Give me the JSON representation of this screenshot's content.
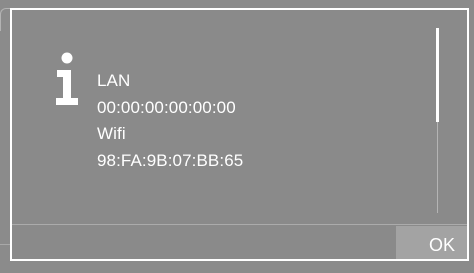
{
  "dialog": {
    "icon": "info-icon",
    "lines": {
      "lan_label": "LAN",
      "lan_mac": "00:00:00:00:00:00",
      "wifi_label": "Wifi",
      "wifi_mac": "98:FA:9B:07:BB:65"
    },
    "ok_label": "OK"
  },
  "colors": {
    "background": "#8b8b8b",
    "dialog_border": "#ffffff",
    "text": "#ffffff",
    "ok_button_bg": "#a3a3a3"
  }
}
